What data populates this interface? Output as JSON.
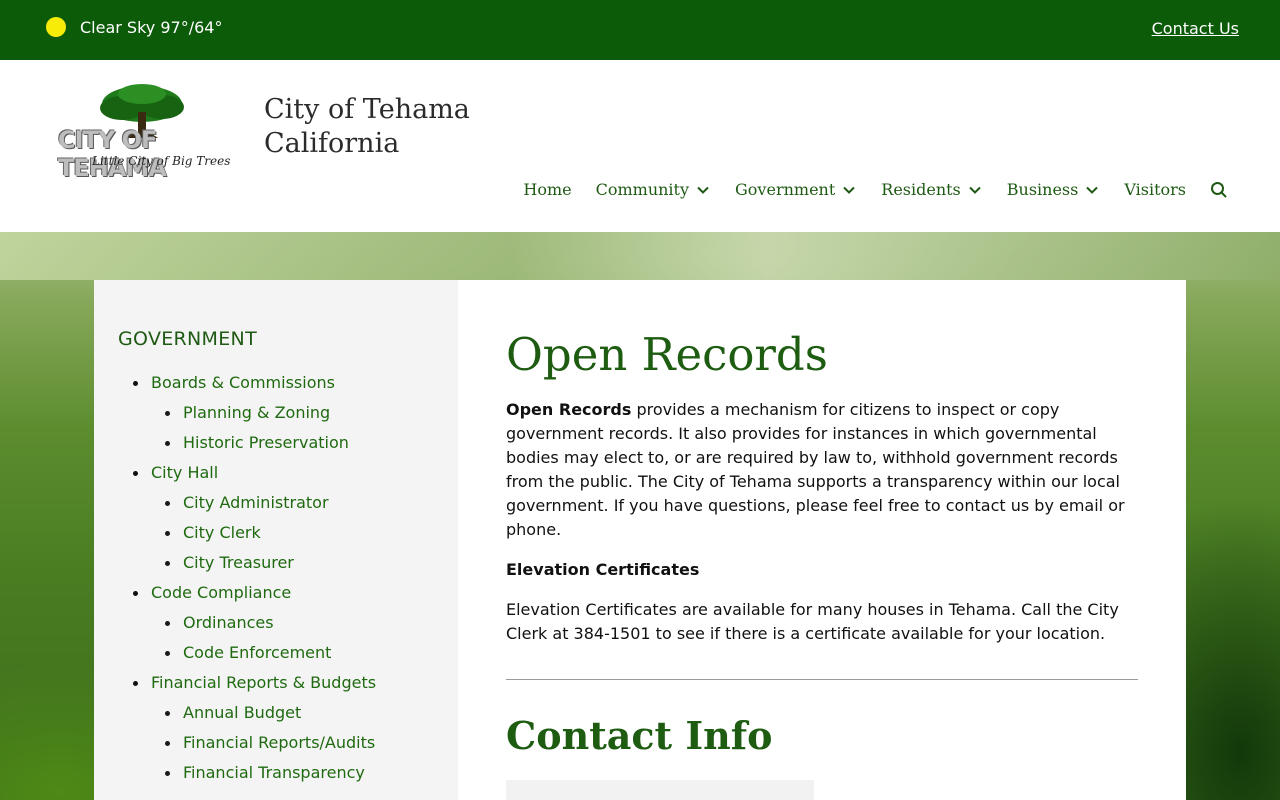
{
  "topbar": {
    "weather_text": "Clear Sky 97°/64°",
    "weather_icon": "sun-icon",
    "contact_link": "Contact Us",
    "background_color": "#0b5b08"
  },
  "header": {
    "logo": {
      "top_text": "CITY OF TEHAMA",
      "tagline": "Little City of Big Trees"
    },
    "site_name_line1": "City of Tehama",
    "site_name_line2": "California",
    "nav": [
      {
        "label": "Home",
        "has_dropdown": false
      },
      {
        "label": "Community",
        "has_dropdown": true
      },
      {
        "label": "Government",
        "has_dropdown": true
      },
      {
        "label": "Residents",
        "has_dropdown": true
      },
      {
        "label": "Business",
        "has_dropdown": true
      },
      {
        "label": "Visitors",
        "has_dropdown": false
      }
    ],
    "search_icon": "search-icon"
  },
  "sidebar": {
    "title": "GOVERNMENT",
    "items": [
      {
        "label": "Boards & Commissions",
        "level": 1
      },
      {
        "label": "Planning & Zoning",
        "level": 2
      },
      {
        "label": "Historic Preservation",
        "level": 2
      },
      {
        "label": "City Hall",
        "level": 1
      },
      {
        "label": "City Administrator",
        "level": 2
      },
      {
        "label": "City Clerk",
        "level": 2
      },
      {
        "label": "City Treasurer",
        "level": 2
      },
      {
        "label": "Code Compliance",
        "level": 1
      },
      {
        "label": "Ordinances",
        "level": 2
      },
      {
        "label": "Code Enforcement",
        "level": 2
      },
      {
        "label": "Financial Reports & Budgets",
        "level": 1
      },
      {
        "label": "Annual Budget",
        "level": 2
      },
      {
        "label": "Financial Reports/Audits",
        "level": 2
      },
      {
        "label": "Financial Transparency",
        "level": 2
      }
    ]
  },
  "content": {
    "title": "Open Records",
    "intro_bold": "Open Records",
    "intro_rest": " provides a mechanism for citizens to inspect or copy government records. It also provides for instances in which governmental bodies may elect to, or are required by law to, withhold government records from the public. The  City of Tehama supports a transparency within our local government.  If you have questions, please feel free to contact us by email or phone.",
    "elevation_heading": "Elevation Certificates",
    "elevation_text": "Elevation Certificates are available for many houses in Tehama.  Call the City Clerk at 384-1501 to see if there is a certificate available for your location.",
    "contact_title": "Contact Info"
  },
  "colors": {
    "brand_green": "#1d5c11",
    "link_green": "#1f6a10",
    "sidebar_bg": "#f4f4f4"
  }
}
